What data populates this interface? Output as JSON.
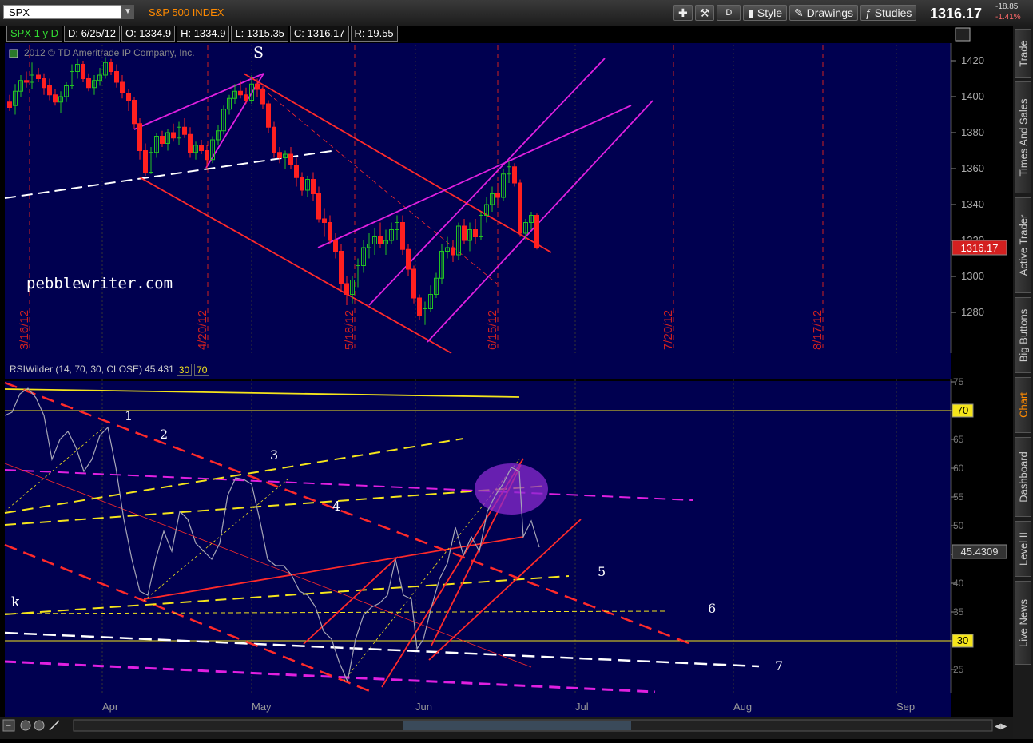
{
  "toolbar": {
    "symbol": "SPX",
    "index_name": "S&P 500 INDEX",
    "period_button": "D",
    "style_label": "Style",
    "drawings_label": "Drawings",
    "studies_label": "Studies",
    "last_price": "1316.17",
    "change": "-18.85",
    "change_pct": "-1.41%"
  },
  "info_bar": {
    "symbol_period": "SPX 1 y D",
    "date": "D: 6/25/12",
    "open": "O: 1334.9",
    "high": "H: 1334.9",
    "low": "L: 1315.35",
    "close": "C: 1316.17",
    "range": "R: 19.55"
  },
  "copyright": "2012 © TD Ameritrade IP Company, Inc.",
  "watermark": "pebblewriter.com",
  "side_tabs": [
    "Trade",
    "Times And Sales",
    "Active Trader",
    "Big Buttons",
    "Chart",
    "Dashboard",
    "Level II",
    "Live News"
  ],
  "active_tab": "Chart",
  "rsi_study": {
    "label": "RSIWilder (14, 70, 30, CLOSE)",
    "value": "45.431",
    "overbought": "30",
    "oversold": "70",
    "value_badge": "45.4309",
    "line70_badge": "70",
    "line30_badge": "30"
  },
  "colors": {
    "background": "#000050",
    "price_badge": "#d42020",
    "up_candle": "#22c322",
    "down_candle": "#ff2020",
    "magenta": "#e020e0",
    "yellow": "#f5e51b"
  },
  "price_axis": {
    "ticks": [
      "1420",
      "1400",
      "1380",
      "1360",
      "1340",
      "1320",
      "1300",
      "1280"
    ]
  },
  "rsi_axis": {
    "ticks": [
      "75",
      "70",
      "65",
      "60",
      "55",
      "50",
      "45",
      "40",
      "35",
      "30",
      "25"
    ]
  },
  "date_markers": [
    "3/16/12",
    "4/20/12",
    "5/18/12",
    "6/15/12",
    "7/20/12",
    "8/17/12"
  ],
  "months": [
    "Apr",
    "May",
    "Jun",
    "Jul",
    "Aug",
    "Sep"
  ],
  "annotations": {
    "S": "S",
    "k": "k",
    "n1": "1",
    "n2": "2",
    "n3": "3",
    "n4": "4",
    "n5": "5",
    "n6": "6",
    "n7": "7"
  }
}
